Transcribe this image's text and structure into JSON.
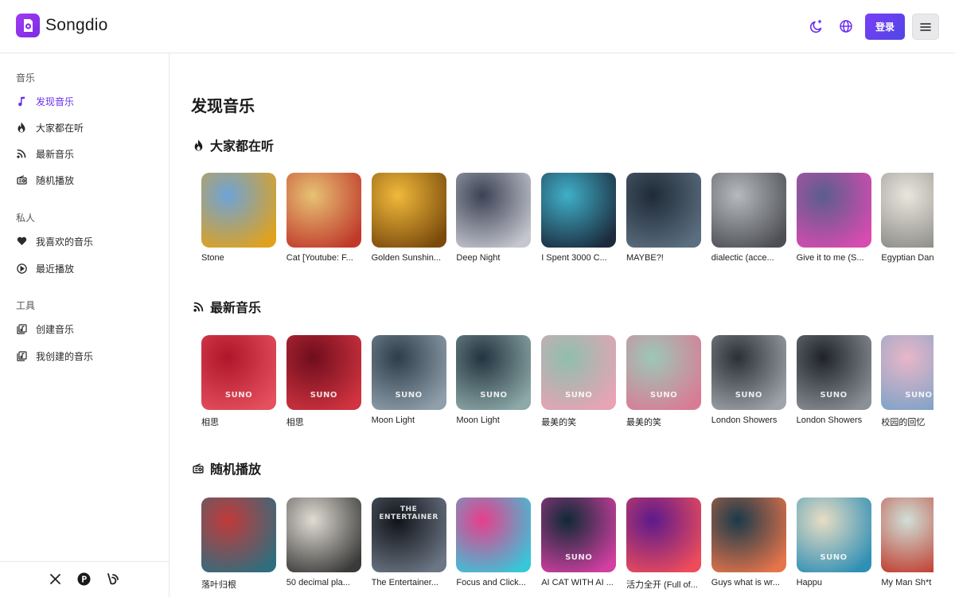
{
  "app": {
    "name": "Songdio",
    "login_label": "登录"
  },
  "colors": {
    "accent": "#6a2ff0",
    "button_gradient": [
      "#7a3ef5",
      "#4f46e5"
    ]
  },
  "topbar_icons": [
    "moon-icon",
    "globe-icon",
    "menu-icon"
  ],
  "sidebar": {
    "sections": [
      {
        "label": "音乐",
        "items": [
          {
            "label": "发现音乐",
            "icon": "music-note-icon",
            "active": true
          },
          {
            "label": "大家都在听",
            "icon": "flame-icon",
            "active": false
          },
          {
            "label": "最新音乐",
            "icon": "rss-icon",
            "active": false
          },
          {
            "label": "随机播放",
            "icon": "radio-icon",
            "active": false
          }
        ]
      },
      {
        "label": "私人",
        "items": [
          {
            "label": "我喜欢的音乐",
            "icon": "heart-icon",
            "active": false
          },
          {
            "label": "最近播放",
            "icon": "play-circle-icon",
            "active": false
          }
        ]
      },
      {
        "label": "工具",
        "items": [
          {
            "label": "创建音乐",
            "icon": "create-music-icon",
            "active": false
          },
          {
            "label": "我创建的音乐",
            "icon": "my-music-icon",
            "active": false
          }
        ]
      }
    ],
    "footer_icons": [
      "x-icon",
      "product-hunt-icon",
      "bluesky-icon"
    ]
  },
  "main": {
    "title": "发现音乐",
    "sections": [
      {
        "title": "大家都在听",
        "icon": "flame-icon",
        "songs": [
          {
            "title": "Stone",
            "colors": [
              "#6ea3d8",
              "#e0a21c"
            ]
          },
          {
            "title": "Cat [Youtube: F...",
            "colors": [
              "#e7c274",
              "#c0392b"
            ]
          },
          {
            "title": "Golden Sunshin...",
            "colors": [
              "#f0b93b",
              "#7a4a0c"
            ]
          },
          {
            "title": "Deep Night",
            "colors": [
              "#3b4254",
              "#c5c6cf"
            ]
          },
          {
            "title": "I Spent 3000 C...",
            "colors": [
              "#3fb0c9",
              "#1c2a3c"
            ]
          },
          {
            "title": "MAYBE?!",
            "colors": [
              "#1f2a36",
              "#5c6f80"
            ]
          },
          {
            "title": "dialectic (acce...",
            "colors": [
              "#b6b9bd",
              "#4d4f54"
            ]
          },
          {
            "title": "Give it to me (S...",
            "colors": [
              "#5a5e8e",
              "#d84bb0"
            ]
          },
          {
            "title": "Egyptian Dan",
            "colors": [
              "#e9e6dd",
              "#8b8a86"
            ]
          }
        ]
      },
      {
        "title": "最新音乐",
        "icon": "rss-icon",
        "songs": [
          {
            "title": "相思",
            "colors": [
              "#b0162a",
              "#e4505e"
            ],
            "suno": "SUNO"
          },
          {
            "title": "相思",
            "colors": [
              "#6f0d1c",
              "#d13340"
            ],
            "suno": "SUNO"
          },
          {
            "title": "Moon Light",
            "colors": [
              "#2f3d4b",
              "#8fa0ab"
            ],
            "suno": "SUNO"
          },
          {
            "title": "Moon Light",
            "colors": [
              "#233440",
              "#8da9a8"
            ],
            "suno": "SUNO"
          },
          {
            "title": "最美的笑",
            "colors": [
              "#8fbfae",
              "#e8a3b5"
            ],
            "suno": "SUNO"
          },
          {
            "title": "最美的笑",
            "colors": [
              "#9cc8b8",
              "#d97b95"
            ],
            "suno": "SUNO"
          },
          {
            "title": "London Showers",
            "colors": [
              "#2b3036",
              "#9ea4a9"
            ],
            "suno": "SUNO"
          },
          {
            "title": "London Showers",
            "colors": [
              "#1f2328",
              "#8a9096"
            ],
            "suno": "SUNO"
          },
          {
            "title": "校园的回忆",
            "colors": [
              "#e9b6c8",
              "#7aa2c8"
            ],
            "suno": "SUNO"
          }
        ]
      },
      {
        "title": "随机播放",
        "icon": "radio-icon",
        "songs": [
          {
            "title": "落叶归根",
            "colors": [
              "#c23a3a",
              "#2e6e7e"
            ]
          },
          {
            "title": "50 decimal pla...",
            "colors": [
              "#e0dcd3",
              "#3a3a3a"
            ]
          },
          {
            "title": "The Entertainer...",
            "colors": [
              "#101318",
              "#6c7685"
            ],
            "caption": "THE ENTERTAINER"
          },
          {
            "title": "Focus and Click...",
            "colors": [
              "#e83e8c",
              "#38c6d9"
            ]
          },
          {
            "title": "AI CAT WITH AI ...",
            "colors": [
              "#0f2a36",
              "#d23fa1"
            ],
            "suno": "SUNO"
          },
          {
            "title": "活力全开 (Full of...",
            "colors": [
              "#5c1a8c",
              "#ee4c5b"
            ]
          },
          {
            "title": "Guys what is wr...",
            "colors": [
              "#1a3a4a",
              "#e6744a"
            ]
          },
          {
            "title": "Happu",
            "colors": [
              "#e8ddc4",
              "#2f8fb5"
            ],
            "suno": "SUNO"
          },
          {
            "title": "My Man Sh*t",
            "colors": [
              "#cfe0d8",
              "#c0392b"
            ]
          }
        ]
      }
    ]
  }
}
